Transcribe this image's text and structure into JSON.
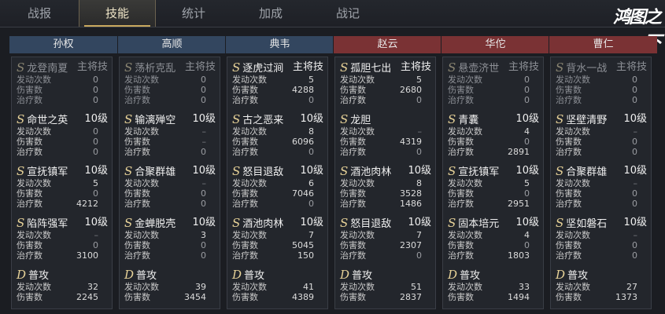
{
  "tabs": [
    "战报",
    "技能",
    "统计",
    "加成",
    "战记"
  ],
  "active_tab": 1,
  "logo": "鸿图之下",
  "heroes": [
    {
      "name": "孙权",
      "side": "blue"
    },
    {
      "name": "高顺",
      "side": "blue"
    },
    {
      "name": "典韦",
      "side": "blue"
    },
    {
      "name": "赵云",
      "side": "red"
    },
    {
      "name": "华佗",
      "side": "red"
    },
    {
      "name": "曹仁",
      "side": "red"
    }
  ],
  "columns": [
    {
      "skills": [
        {
          "grade": "S",
          "name": "龙登南夏",
          "level": "主将技",
          "dim": true,
          "stats": [
            [
              "发动次数",
              "0"
            ],
            [
              "伤害数",
              "0"
            ],
            [
              "治疗数",
              "0"
            ]
          ]
        },
        {
          "grade": "S",
          "name": "命世之英",
          "level": "10级",
          "stats": [
            [
              "发动次数",
              "0"
            ],
            [
              "伤害数",
              "0"
            ],
            [
              "治疗数",
              "0"
            ]
          ]
        },
        {
          "grade": "S",
          "name": "宣抚镇军",
          "level": "10级",
          "stats": [
            [
              "发动次数",
              "5"
            ],
            [
              "伤害数",
              "0"
            ],
            [
              "治疗数",
              "4212"
            ]
          ]
        },
        {
          "grade": "S",
          "name": "陷阵强军",
          "level": "10级",
          "stats": [
            [
              "发动次数",
              "–"
            ],
            [
              "伤害数",
              "0"
            ],
            [
              "治疗数",
              "3100"
            ]
          ]
        },
        {
          "grade": "D",
          "name": "普攻",
          "level": "",
          "stats": [
            [
              "发动次数",
              "32"
            ],
            [
              "伤害数",
              "2245"
            ]
          ]
        }
      ]
    },
    {
      "skills": [
        {
          "grade": "S",
          "name": "荡析克乱",
          "level": "主将技",
          "dim": true,
          "stats": [
            [
              "发动次数",
              "0"
            ],
            [
              "伤害数",
              "0"
            ],
            [
              "治疗数",
              "0"
            ]
          ]
        },
        {
          "grade": "S",
          "name": "输漓殚空",
          "level": "10级",
          "stats": [
            [
              "发动次数",
              "–"
            ],
            [
              "伤害数",
              "–"
            ],
            [
              "治疗数",
              "0"
            ]
          ]
        },
        {
          "grade": "S",
          "name": "合聚群雄",
          "level": "10级",
          "stats": [
            [
              "发动次数",
              "–"
            ],
            [
              "伤害数",
              "0"
            ],
            [
              "治疗数",
              "0"
            ]
          ]
        },
        {
          "grade": "S",
          "name": "金蝉脱壳",
          "level": "10级",
          "stats": [
            [
              "发动次数",
              "3"
            ],
            [
              "伤害数",
              "0"
            ],
            [
              "治疗数",
              "0"
            ]
          ]
        },
        {
          "grade": "D",
          "name": "普攻",
          "level": "",
          "stats": [
            [
              "发动次数",
              "39"
            ],
            [
              "伤害数",
              "3454"
            ]
          ]
        }
      ]
    },
    {
      "skills": [
        {
          "grade": "S",
          "name": "逐虎过涧",
          "level": "主将技",
          "stats": [
            [
              "发动次数",
              "5"
            ],
            [
              "伤害数",
              "4288"
            ],
            [
              "治疗数",
              "0"
            ]
          ]
        },
        {
          "grade": "S",
          "name": "古之恶来",
          "level": "10级",
          "stats": [
            [
              "发动次数",
              "8"
            ],
            [
              "伤害数",
              "6096"
            ],
            [
              "治疗数",
              "0"
            ]
          ]
        },
        {
          "grade": "S",
          "name": "怒目退敌",
          "level": "10级",
          "stats": [
            [
              "发动次数",
              "6"
            ],
            [
              "伤害数",
              "7046"
            ],
            [
              "治疗数",
              "0"
            ]
          ]
        },
        {
          "grade": "S",
          "name": "酒池肉林",
          "level": "10级",
          "stats": [
            [
              "发动次数",
              "7"
            ],
            [
              "伤害数",
              "5045"
            ],
            [
              "治疗数",
              "150"
            ]
          ]
        },
        {
          "grade": "D",
          "name": "普攻",
          "level": "",
          "stats": [
            [
              "发动次数",
              "41"
            ],
            [
              "伤害数",
              "4389"
            ]
          ]
        }
      ]
    },
    {
      "skills": [
        {
          "grade": "S",
          "name": "孤胆七出",
          "level": "主将技",
          "stats": [
            [
              "发动次数",
              "5"
            ],
            [
              "伤害数",
              "2680"
            ],
            [
              "治疗数",
              "0"
            ]
          ]
        },
        {
          "grade": "S",
          "name": "龙胆",
          "level": "",
          "stats": [
            [
              "发动次数",
              "–"
            ],
            [
              "伤害数",
              "4319"
            ],
            [
              "治疗数",
              "0"
            ]
          ]
        },
        {
          "grade": "S",
          "name": "酒池肉林",
          "level": "10级",
          "stats": [
            [
              "发动次数",
              "8"
            ],
            [
              "伤害数",
              "3528"
            ],
            [
              "治疗数",
              "1486"
            ]
          ]
        },
        {
          "grade": "S",
          "name": "怒目退敌",
          "level": "10级",
          "stats": [
            [
              "发动次数",
              "7"
            ],
            [
              "伤害数",
              "2307"
            ],
            [
              "治疗数",
              "0"
            ]
          ]
        },
        {
          "grade": "D",
          "name": "普攻",
          "level": "",
          "stats": [
            [
              "发动次数",
              "51"
            ],
            [
              "伤害数",
              "2837"
            ]
          ]
        }
      ]
    },
    {
      "skills": [
        {
          "grade": "S",
          "name": "悬壶济世",
          "level": "主将技",
          "dim": true,
          "stats": [
            [
              "发动次数",
              "0"
            ],
            [
              "伤害数",
              "0"
            ],
            [
              "治疗数",
              "0"
            ]
          ]
        },
        {
          "grade": "S",
          "name": "青囊",
          "level": "10级",
          "stats": [
            [
              "发动次数",
              "4"
            ],
            [
              "伤害数",
              "0"
            ],
            [
              "治疗数",
              "2891"
            ]
          ]
        },
        {
          "grade": "S",
          "name": "宣抚镇军",
          "level": "10级",
          "stats": [
            [
              "发动次数",
              "5"
            ],
            [
              "伤害数",
              "0"
            ],
            [
              "治疗数",
              "2951"
            ]
          ]
        },
        {
          "grade": "S",
          "name": "固本培元",
          "level": "10级",
          "stats": [
            [
              "发动次数",
              "4"
            ],
            [
              "伤害数",
              "0"
            ],
            [
              "治疗数",
              "1803"
            ]
          ]
        },
        {
          "grade": "D",
          "name": "普攻",
          "level": "",
          "stats": [
            [
              "发动次数",
              "33"
            ],
            [
              "伤害数",
              "1494"
            ]
          ]
        }
      ]
    },
    {
      "skills": [
        {
          "grade": "S",
          "name": "背水一战",
          "level": "主将技",
          "dim": true,
          "stats": [
            [
              "发动次数",
              "0"
            ],
            [
              "伤害数",
              "0"
            ],
            [
              "治疗数",
              "0"
            ]
          ]
        },
        {
          "grade": "S",
          "name": "坚壁清野",
          "level": "10级",
          "stats": [
            [
              "发动次数",
              "–"
            ],
            [
              "伤害数",
              "0"
            ],
            [
              "治疗数",
              "0"
            ]
          ]
        },
        {
          "grade": "S",
          "name": "合聚群雄",
          "level": "10级",
          "stats": [
            [
              "发动次数",
              "–"
            ],
            [
              "伤害数",
              "0"
            ],
            [
              "治疗数",
              "0"
            ]
          ]
        },
        {
          "grade": "S",
          "name": "坚如磐石",
          "level": "10级",
          "stats": [
            [
              "发动次数",
              "–"
            ],
            [
              "伤害数",
              "0"
            ],
            [
              "治疗数",
              "0"
            ]
          ]
        },
        {
          "grade": "D",
          "name": "普攻",
          "level": "",
          "stats": [
            [
              "发动次数",
              "27"
            ],
            [
              "伤害数",
              "1373"
            ]
          ]
        }
      ]
    }
  ]
}
